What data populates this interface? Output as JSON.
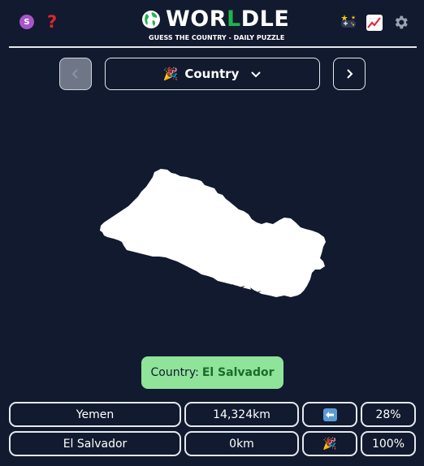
{
  "header": {
    "avatar_letter": "S",
    "help_symbol": "?",
    "title_prefix": "WOR",
    "title_highlight": "L",
    "title_suffix": "DLE",
    "subtitle": "GUESS THE COUNTRY - DAILY PUZZLE",
    "icons": [
      "avatar",
      "help-icon",
      "globe-icon",
      "games-icon",
      "stats-icon",
      "gear-icon"
    ]
  },
  "toolbar": {
    "mode_emoji": "🎉",
    "mode_label": "Country",
    "prev_enabled": false,
    "next_enabled": true
  },
  "answer": {
    "label": "Country:",
    "value": "El Salvador"
  },
  "guesses": [
    {
      "name": "Yemen",
      "distance": "14,324km",
      "direction": "west-arrow",
      "proximity": "28%"
    },
    {
      "name": "El Salvador",
      "distance": "0km",
      "direction_emoji": "🎉",
      "proximity": "100%"
    }
  ],
  "colors": {
    "background": "#111a2e",
    "brand_green": "#22b14c",
    "answer_bg": "#8fe49a",
    "answer_value": "#1b6b2c",
    "help_red": "#e0242f",
    "arrow_blue": "#5b9bd5"
  }
}
